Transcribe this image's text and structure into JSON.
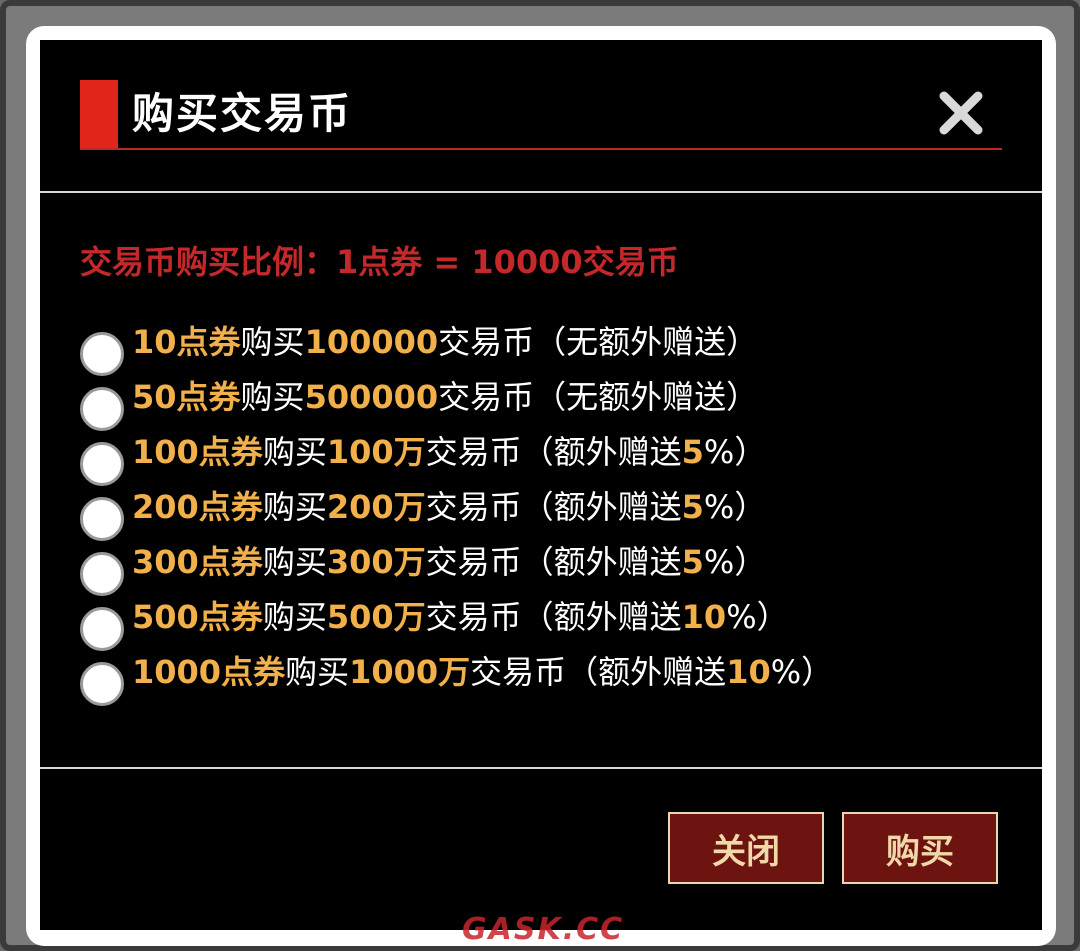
{
  "dialog": {
    "title": "购买交易币",
    "close_icon": "close-x-icon",
    "accent_color": "#e1251b"
  },
  "rate_text": "交易币购买比例：1点券 = 10000交易币",
  "options": [
    {
      "points": "10点券",
      "mid": "购买",
      "coins": "100000",
      "suffix": "交易币（无额外赠送）",
      "bonus": "",
      "end": ""
    },
    {
      "points": "50点券",
      "mid": "购买",
      "coins": "500000",
      "suffix": "交易币（无额外赠送）",
      "bonus": "",
      "end": ""
    },
    {
      "points": "100点券",
      "mid": "购买",
      "coins": "100万",
      "suffix": "交易币（额外赠送",
      "bonus": "5",
      "end": "%）"
    },
    {
      "points": "200点券",
      "mid": "购买",
      "coins": "200万",
      "suffix": "交易币（额外赠送",
      "bonus": "5",
      "end": "%）"
    },
    {
      "points": "300点券",
      "mid": "购买",
      "coins": "300万",
      "suffix": "交易币（额外赠送",
      "bonus": "5",
      "end": "%）"
    },
    {
      "points": "500点券",
      "mid": "购买",
      "coins": "500万",
      "suffix": "交易币（额外赠送",
      "bonus": "10",
      "end": "%）"
    },
    {
      "points": "1000点券",
      "mid": "购买",
      "coins": "1000万",
      "suffix": "交易币（额外赠送",
      "bonus": "10",
      "end": "%）"
    }
  ],
  "buttons": {
    "close_label": "关闭",
    "buy_label": "购买"
  },
  "watermark": "GASK.CC",
  "colors": {
    "highlight": "#f2b04a",
    "rate": "#c4282a",
    "button_bg": "#6e1410"
  }
}
